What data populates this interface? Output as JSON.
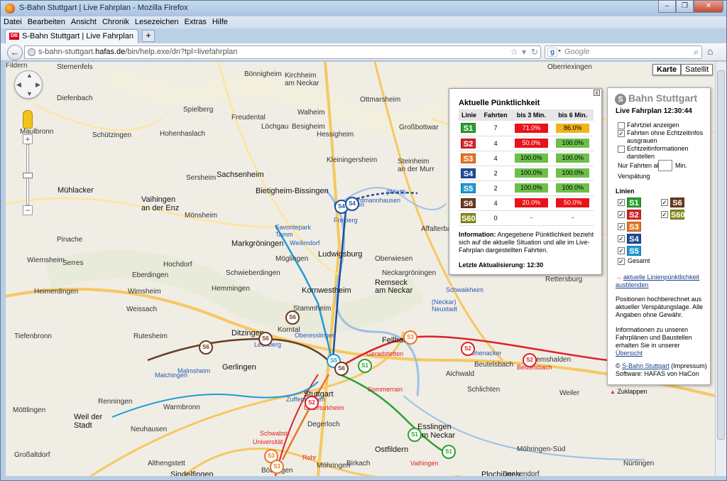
{
  "window": {
    "title": "S-Bahn Stuttgart | Live Fahrplan - Mozilla Firefox",
    "min": "‒",
    "max": "❐",
    "close": "✕"
  },
  "menu": [
    "Datei",
    "Bearbeiten",
    "Ansicht",
    "Chronik",
    "Lesezeichen",
    "Extras",
    "Hilfe"
  ],
  "tab": {
    "favicon": "DB",
    "title": "S-Bahn Stuttgart | Live Fahrplan",
    "new_tab": "+"
  },
  "nav": {
    "back_icon": "back-arrow-icon",
    "url_host_pre": "s-bahn-stuttgart.",
    "url_host": "hafas.de",
    "url_path": "/bin/help.exe/dn?tpl=livefahrplan",
    "search_engine": "g",
    "search_placeholder": "Google"
  },
  "map": {
    "type_buttons": [
      "Karte",
      "Satellit"
    ],
    "selected_type": "Karte",
    "labels": [
      {
        "t": "Sternenfels",
        "c": "lbl"
      },
      {
        "t": "Bönnigheim",
        "c": "lbl"
      },
      {
        "t": "Kirchheim",
        "c": "lbl"
      },
      {
        "t": "am Neckar",
        "c": "lbl"
      },
      {
        "t": "Diefenbach",
        "c": "lbl"
      },
      {
        "t": "Spielberg",
        "c": "lbl"
      },
      {
        "t": "Freudental",
        "c": "lbl"
      },
      {
        "t": "Walheim",
        "c": "lbl"
      },
      {
        "t": "Ottmarsheim",
        "c": "lbl"
      },
      {
        "t": "Löchgau",
        "c": "lbl"
      },
      {
        "t": "Besigheim",
        "c": "lbl"
      },
      {
        "t": "Hessigheim",
        "c": "lbl"
      },
      {
        "t": "Großbottwar",
        "c": "lbl"
      },
      {
        "t": "Maulbronn",
        "c": "lbl"
      },
      {
        "t": "Schützingen",
        "c": "lbl"
      },
      {
        "t": "Hohenhaslach",
        "c": "lbl"
      },
      {
        "t": "Kleiningersheim",
        "c": "lbl"
      },
      {
        "t": "Steinheim",
        "c": "lbl"
      },
      {
        "t": "an der Murr",
        "c": "lbl"
      },
      {
        "t": "Sachsenheim",
        "c": "lbl big"
      },
      {
        "t": "Sersheim",
        "c": "lbl"
      },
      {
        "t": "Mühlacker",
        "c": "lbl big"
      },
      {
        "t": "Vaihingen",
        "c": "lbl big"
      },
      {
        "t": "an der Enz",
        "c": "lbl big"
      },
      {
        "t": "Bietigheim-Bissingen",
        "c": "lbl big"
      },
      {
        "t": "Markgröningen",
        "c": "lbl big"
      },
      {
        "t": "Möglingen",
        "c": "lbl"
      },
      {
        "t": "Ludwigsburg",
        "c": "lbl big"
      },
      {
        "t": "Oberwiesen",
        "c": "lbl"
      },
      {
        "t": "Schwieberdingen",
        "c": "lbl"
      },
      {
        "t": "Neckargröningen",
        "c": "lbl"
      },
      {
        "t": "Hemmingen",
        "c": "lbl"
      },
      {
        "t": "Remseck",
        "c": "lbl big"
      },
      {
        "t": "am Neckar",
        "c": "lbl big"
      },
      {
        "t": "Kornwestheim",
        "c": "lbl big"
      },
      {
        "t": "Stammheim",
        "c": "lbl"
      },
      {
        "t": "Ditzingen",
        "c": "lbl big"
      },
      {
        "t": "Korntal",
        "c": "lbl"
      },
      {
        "t": "Fellbach",
        "c": "lbl big"
      },
      {
        "t": "Gerlingen",
        "c": "lbl big"
      },
      {
        "t": "Stuttgart",
        "c": "lbl big"
      },
      {
        "t": "Esslingen",
        "c": "lbl big"
      },
      {
        "t": "am Neckar",
        "c": "lbl big"
      },
      {
        "t": "Ostfildern",
        "c": "lbl big"
      },
      {
        "t": "Weissach",
        "c": "lbl"
      },
      {
        "t": "Tiefenbronn",
        "c": "lbl"
      },
      {
        "t": "Rutesheim",
        "c": "lbl"
      },
      {
        "t": "Weil der",
        "c": "lbl big"
      },
      {
        "t": "Stadt",
        "c": "lbl big"
      },
      {
        "t": "Möttlingen",
        "c": "lbl"
      },
      {
        "t": "Warmbronn",
        "c": "lbl"
      },
      {
        "t": "Sindelfingen",
        "c": "lbl big"
      },
      {
        "t": "Degerloch",
        "c": "lbl"
      },
      {
        "t": "Birkach",
        "c": "lbl"
      },
      {
        "t": "Plochingen",
        "c": "lbl big"
      },
      {
        "t": "Beutelsbach",
        "c": "lbl"
      },
      {
        "t": "Aichwald",
        "c": "lbl"
      },
      {
        "t": "Schlichten",
        "c": "lbl"
      },
      {
        "t": "Weiler",
        "c": "lbl"
      },
      {
        "t": "Remshalden",
        "c": "lbl"
      },
      {
        "t": "Affalterbach",
        "c": "lbl"
      },
      {
        "t": "Rettersburg",
        "c": "lbl"
      },
      {
        "t": "Schwaikheim",
        "c": "lbl blue"
      },
      {
        "t": "Nürtingen",
        "c": "lbl"
      },
      {
        "t": "Denkendorf",
        "c": "lbl"
      },
      {
        "t": "Wiernsheim",
        "c": "lbl"
      },
      {
        "t": "Serres",
        "c": "lbl"
      },
      {
        "t": "Pinache",
        "c": "lbl"
      },
      {
        "t": "Hochdorf",
        "c": "lbl"
      },
      {
        "t": "Eberdingen",
        "c": "lbl"
      },
      {
        "t": "Heimerdingen",
        "c": "lbl"
      },
      {
        "t": "Wimsheim",
        "c": "lbl"
      },
      {
        "t": "Mönsheim",
        "c": "lbl"
      },
      {
        "t": "Oberriexingen",
        "c": "lbl"
      },
      {
        "t": "Großaltdorf",
        "c": "lbl"
      },
      {
        "t": "Althengstett",
        "c": "lbl"
      },
      {
        "t": "Maichingen",
        "c": "lbl blue"
      },
      {
        "t": "Renningen",
        "c": "lbl"
      },
      {
        "t": "Malmsheim",
        "c": "lbl blue"
      },
      {
        "t": "Leonberg",
        "c": "lbl blue"
      },
      {
        "t": "Weilimdorf",
        "c": "lbl blue"
      },
      {
        "t": "Favoritepark",
        "c": "lbl blue"
      },
      {
        "t": "Tamm",
        "c": "lbl blue"
      },
      {
        "t": "(Württ)",
        "c": "lbl blue"
      },
      {
        "t": "Erdmannhausen",
        "c": "lbl blue"
      },
      {
        "t": "Benningen",
        "c": "lbl blue"
      },
      {
        "t": "Freiberg",
        "c": "lbl blue"
      },
      {
        "t": "(Neckar)",
        "c": "lbl blue"
      },
      {
        "t": "Neustadt",
        "c": "lbl blue"
      },
      {
        "t": "Hohenacker",
        "c": "lbl blue"
      },
      {
        "t": "Beutelsbach",
        "c": "lbl red"
      },
      {
        "t": "Geradstetten",
        "c": "lbl red"
      },
      {
        "t": "Sommerrain",
        "c": "lbl red"
      },
      {
        "t": "Unterturkheim",
        "c": "lbl red"
      },
      {
        "t": "Schwabstr.",
        "c": "lbl red"
      },
      {
        "t": "Universität",
        "c": "lbl red"
      },
      {
        "t": "Vaihingen",
        "c": "lbl red"
      },
      {
        "t": "Oberesslingen",
        "c": "lbl blue"
      },
      {
        "t": "Zuffenhausen",
        "c": "lbl blue"
      },
      {
        "t": "Neuhausen",
        "c": "lbl"
      },
      {
        "t": "Böblingen",
        "c": "lbl"
      },
      {
        "t": "Rohr",
        "c": "lbl red"
      },
      {
        "t": "Möhringen",
        "c": "lbl"
      },
      {
        "t": "Möhringen-Süd",
        "c": "lbl"
      },
      {
        "t": "Fildern",
        "c": "lbl"
      }
    ],
    "pins": [
      {
        "t": "S4",
        "c": "#1e4e9a"
      },
      {
        "t": "S4",
        "c": "#1e4e9a"
      },
      {
        "t": "S5",
        "c": "#1e9bd7"
      },
      {
        "t": "S6",
        "c": "#6b3b20"
      },
      {
        "t": "S6",
        "c": "#6b3b20"
      },
      {
        "t": "S6",
        "c": "#6b3b20"
      },
      {
        "t": "S6",
        "c": "#6b3b20"
      },
      {
        "t": "S1",
        "c": "#2d9f2f"
      },
      {
        "t": "S1",
        "c": "#2d9f2f"
      },
      {
        "t": "S1",
        "c": "#2d9f2f"
      },
      {
        "t": "S2",
        "c": "#d8232a"
      },
      {
        "t": "S2",
        "c": "#d8232a"
      },
      {
        "t": "S2",
        "c": "#d8232a"
      },
      {
        "t": "S3",
        "c": "#e87722"
      },
      {
        "t": "S3",
        "c": "#e87722"
      },
      {
        "t": "S3",
        "c": "#e87722"
      }
    ]
  },
  "punctuality": {
    "title": "Aktuelle Pünktlichkeit",
    "close": "x",
    "headers": [
      "Linie",
      "Fahrten",
      "bis 3 Min.",
      "bis 6 Min."
    ],
    "rows": [
      {
        "line": "S1",
        "color": "#2d9f2f",
        "trips": "7",
        "m3": "71.0%",
        "m3c": "#e8131a",
        "m6": "86.0%",
        "m6c": "#f2b21b"
      },
      {
        "line": "S2",
        "color": "#d8232a",
        "trips": "4",
        "m3": "50.0%",
        "m3c": "#e8131a",
        "m6": "100.0%",
        "m6c": "#6cc04a"
      },
      {
        "line": "S3",
        "color": "#e87722",
        "trips": "4",
        "m3": "100.0%",
        "m3c": "#6cc04a",
        "m6": "100.0%",
        "m6c": "#6cc04a"
      },
      {
        "line": "S4",
        "color": "#1e4e9a",
        "trips": "2",
        "m3": "100.0%",
        "m3c": "#6cc04a",
        "m6": "100.0%",
        "m6c": "#6cc04a"
      },
      {
        "line": "S5",
        "color": "#1e9bd7",
        "trips": "2",
        "m3": "100.0%",
        "m3c": "#6cc04a",
        "m6": "100.0%",
        "m6c": "#6cc04a"
      },
      {
        "line": "S6",
        "color": "#6b3b20",
        "trips": "4",
        "m3": "20.0%",
        "m3c": "#e8131a",
        "m6": "50.0%",
        "m6c": "#e8131a"
      },
      {
        "line": "S60",
        "color": "#8a8c1a",
        "trips": "0",
        "m3": "-",
        "m3c": "",
        "m6": "-",
        "m6c": ""
      }
    ],
    "info_label": "Information:",
    "info_text": "Angegebene Pünktlichkeit bezieht sich auf die aktuelle Situation und alle im Live-Fahrplan dargestellten Fahrten.",
    "update_label": "Letzte Aktualisierung:",
    "update_time": "12:30"
  },
  "sidebar": {
    "logo_letter": "S",
    "logo_text": "Bahn Stuttgart",
    "time_label": "Live Fahrplan 12:30:44",
    "opt1": "Fahrtziel anzeigen",
    "opt2a": "Fahrten ohne Echtzeitinfos",
    "opt2b": "ausgrauen",
    "opt3a": "Echtzeitinformationen",
    "opt3b": "darstellen",
    "delay_pre": "Nur Fahrten ab",
    "delay_post": "Min.",
    "delay_post2": "Verspätung",
    "delay_value": "",
    "lines_title": "Linien",
    "lines": [
      "S1",
      "S2",
      "S3",
      "S4",
      "S5",
      "S6",
      "S60"
    ],
    "total": "Gesamt",
    "link1a": "aktuelle Linienpünktlichkeit",
    "link1b": "ausblenden",
    "text1": "Positionen hochberechnet aus aktueller Verspätungslage. Alle Angaben ohne Gewähr.",
    "text2": "Informationen zu unseren Fahrplänen und Baustellen erhalten Sie in unserer",
    "text2_link": "Übersicht",
    "copy1_pre": "©",
    "copy1_link": "S-Bahn Stuttgart",
    "copy1_post": "(Impressum)",
    "copy2": "Software: HAFAS von HaCon",
    "collapse": "Zuklappen"
  }
}
